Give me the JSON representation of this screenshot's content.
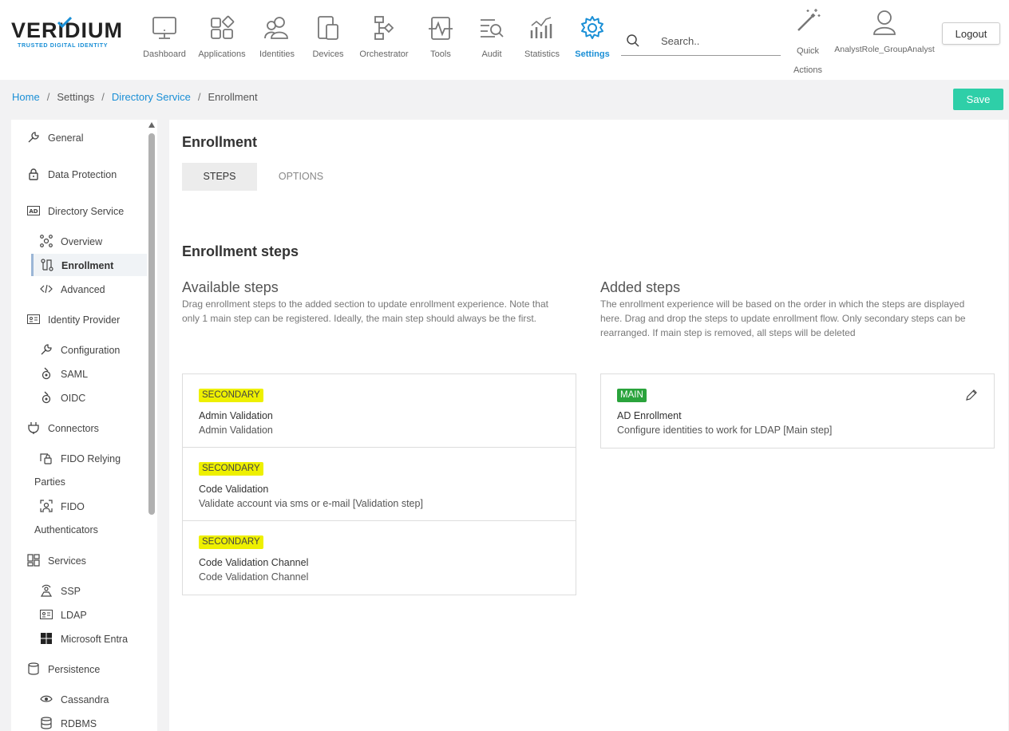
{
  "brand": {
    "name": "VERIDIUM",
    "tagline": "TRUSTED DIGITAL IDENTITY"
  },
  "nav": {
    "items": [
      {
        "label": "Dashboard",
        "icon": "monitor-icon"
      },
      {
        "label": "Applications",
        "icon": "apps-grid-icon"
      },
      {
        "label": "Identities",
        "icon": "users-icon"
      },
      {
        "label": "Devices",
        "icon": "devices-icon"
      },
      {
        "label": "Orchestrator",
        "icon": "flow-icon"
      },
      {
        "label": "Tools",
        "icon": "pulse-icon"
      },
      {
        "label": "Audit",
        "icon": "audit-icon"
      },
      {
        "label": "Statistics",
        "icon": "chart-icon"
      },
      {
        "label": "Settings",
        "icon": "gear-icon",
        "active": true
      }
    ],
    "search_placeholder": "Search..",
    "quick_actions": "Quick Actions",
    "user": "AnalystRole_GroupAnalyst",
    "logout": "Logout"
  },
  "breadcrumb": {
    "home": "Home",
    "settings": "Settings",
    "directory": "Directory Service",
    "current": "Enrollment"
  },
  "save_label": "Save",
  "sidebar": {
    "general": "General",
    "data_protection": "Data Protection",
    "directory_service": "Directory Service",
    "overview": "Overview",
    "enrollment": "Enrollment",
    "advanced": "Advanced",
    "identity_provider": "Identity Provider",
    "configuration": "Configuration",
    "saml": "SAML",
    "oidc": "OIDC",
    "connectors": "Connectors",
    "fido_relying_1": "FIDO Relying",
    "fido_relying_2": "Parties",
    "fido_auth_1": "FIDO",
    "fido_auth_2": "Authenticators",
    "services": "Services",
    "ssp": "SSP",
    "ldap": "LDAP",
    "microsoft_entra": "Microsoft Entra",
    "persistence": "Persistence",
    "cassandra": "Cassandra",
    "rdbms": "RDBMS"
  },
  "main": {
    "title": "Enrollment",
    "tabs": {
      "steps": "STEPS",
      "options": "OPTIONS"
    },
    "section_title": "Enrollment steps",
    "available": {
      "title": "Available steps",
      "desc": "Drag enrollment steps to the added section to update enrollment experience. Note that only 1 main step can be registered. Ideally, the main step should always be the first.",
      "cards": [
        {
          "badge": "SECONDARY",
          "name": "Admin Validation",
          "desc": "Admin Validation"
        },
        {
          "badge": "SECONDARY",
          "name": "Code Validation",
          "desc": "Validate account via sms or e-mail [Validation step]"
        },
        {
          "badge": "SECONDARY",
          "name": "Code Validation Channel",
          "desc": "Code Validation Channel"
        }
      ]
    },
    "added": {
      "title": "Added steps",
      "desc": "The enrollment experience will be based on the order in which the steps are displayed here. Drag and drop the steps to update enrollment flow. Only secondary steps can be rearranged. If main step is removed, all steps will be deleted",
      "cards": [
        {
          "badge": "MAIN",
          "name": "AD Enrollment",
          "desc": "Configure identities to work for LDAP [Main step]"
        }
      ]
    }
  },
  "colors": {
    "accent": "#1a8fd6",
    "save": "#2ecfa8",
    "secondary_badge": "#eef000",
    "main_badge": "#2aa33c"
  }
}
